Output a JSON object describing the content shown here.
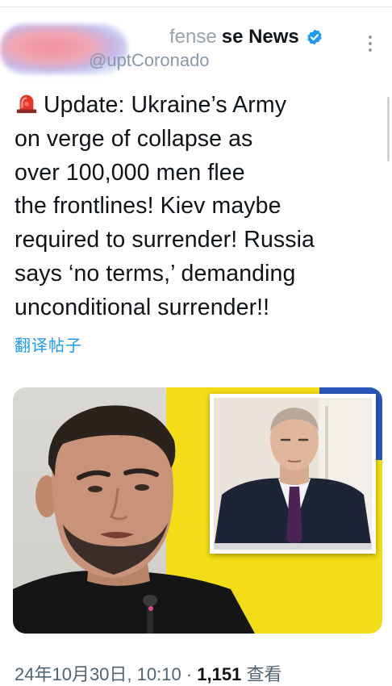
{
  "header": {
    "display_name_faded": "fense",
    "display_name": "se News",
    "handle": "@uptCoronado"
  },
  "tweet": {
    "lines": [
      "Update: Ukraine’s Army",
      "on verge of collapse as",
      "over 100,000 men flee",
      "the frontlines! Kiev maybe",
      "required to surrender! Russia",
      "says ‘no terms,’ demanding",
      "unconditional surrender!!"
    ],
    "emoji": "rotating-light",
    "translate_label": "翻译帖子"
  },
  "meta": {
    "date_time": "24年10月30日, 10:10",
    "separator": "·",
    "views_count": "1,151",
    "views_label": "查看"
  },
  "colors": {
    "link": "#1d9bf0",
    "verified": "#1d9bf0",
    "text": "#0f1419",
    "muted": "#536471",
    "flag_yellow": "#f2dd16",
    "flag_blue": "#2a56b9"
  }
}
